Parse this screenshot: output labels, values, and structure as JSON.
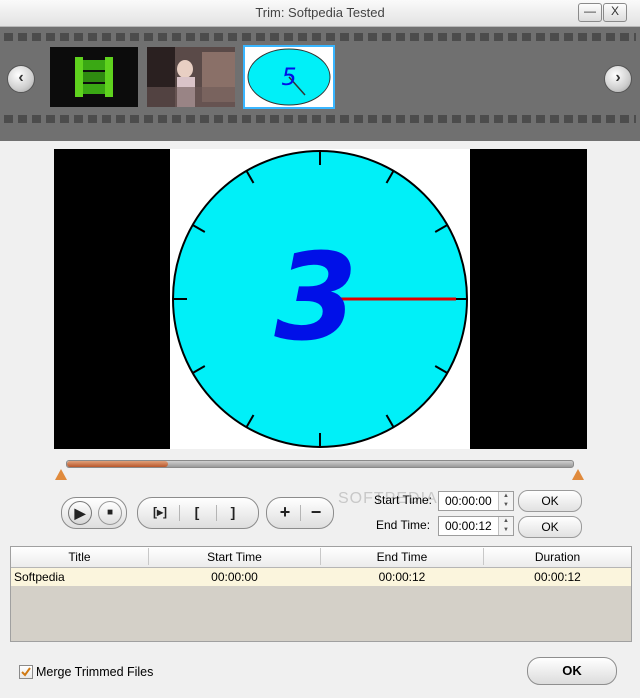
{
  "window": {
    "title": "Trim: Softpedia Tested",
    "minimize_glyph": "—",
    "close_glyph": "X"
  },
  "filmstrip": {
    "prev_icon": "chevron-left-icon",
    "next_icon": "chevron-right-icon",
    "thumbnails": [
      {
        "icon": "film-icon"
      },
      {
        "icon": "video-frame-thumbnail"
      },
      {
        "icon": "countdown-clock-thumbnail",
        "digit": "5",
        "selected": true
      }
    ]
  },
  "preview": {
    "countdown_digit": "3",
    "face_color": "#00f0f8",
    "digit_color": "#0010e8",
    "hand_color": "#e00000"
  },
  "timeline": {
    "progress_fraction": 0.2,
    "fill_color": "#b9572c"
  },
  "controls": {
    "play_glyph": "▶",
    "stop_glyph": "■",
    "trim_glyph": "[▸]",
    "mark_in_glyph": "[",
    "mark_out_glyph": "]",
    "add_glyph": "+",
    "remove_glyph": "−",
    "start_time_label": "Start Time:",
    "start_time_value": "00:00:00",
    "end_time_label": "End Time:",
    "end_time_value": "00:00:12",
    "ok_label": "OK"
  },
  "table": {
    "columns": [
      "Title",
      "Start Time",
      "End Time",
      "Duration"
    ],
    "rows": [
      {
        "title": "Softpedia",
        "start": "00:00:00",
        "end": "00:00:12",
        "duration": "00:00:12"
      }
    ]
  },
  "footer": {
    "merge_label": "Merge Trimmed Files",
    "merge_checked": true,
    "ok_label": "OK"
  },
  "watermark": "SOFTPEDIA"
}
